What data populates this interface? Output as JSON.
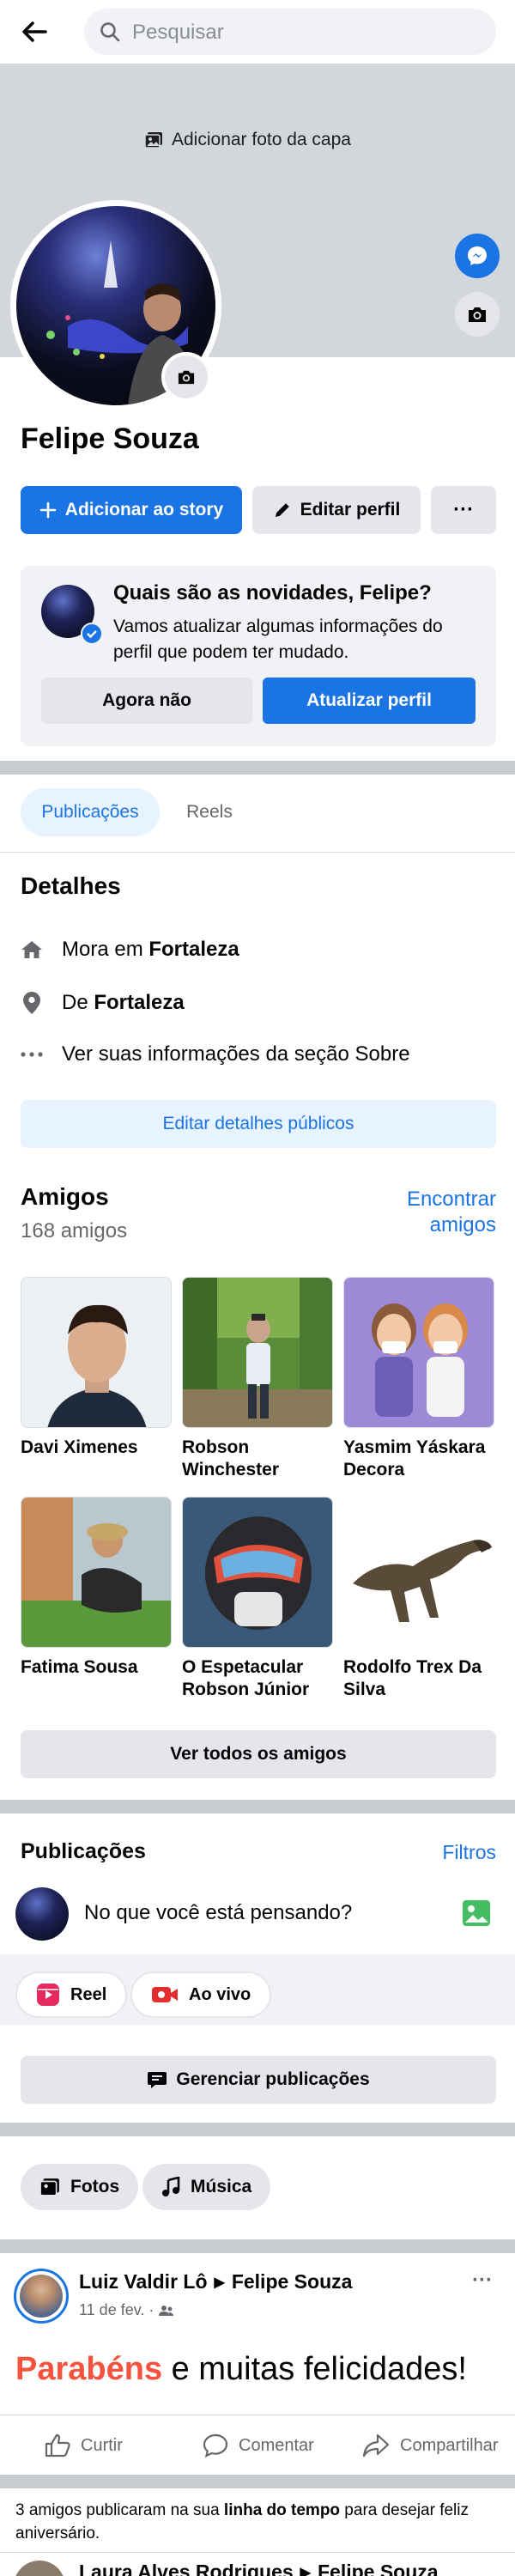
{
  "header": {
    "search_placeholder": "Pesquisar"
  },
  "cover": {
    "add_cover_label": "Adicionar foto da capa"
  },
  "profile": {
    "name": "Felipe Souza",
    "add_story_label": "Adicionar ao story",
    "edit_profile_label": "Editar perfil",
    "more_label": "···"
  },
  "update_card": {
    "title": "Quais são as novidades, Felipe?",
    "body": "Vamos atualizar algumas informações do perfil que podem ter mudado.",
    "not_now_label": "Agora não",
    "update_label": "Atualizar perfil"
  },
  "tabs": [
    {
      "label": "Publicações"
    },
    {
      "label": "Reels"
    }
  ],
  "details": {
    "title": "Detalhes",
    "lives_prefix": "Mora em ",
    "lives_city": "Fortaleza",
    "from_prefix": "De ",
    "from_city": "Fortaleza",
    "about_link": "Ver suas informações da seção Sobre",
    "edit_button": "Editar detalhes públicos"
  },
  "friends": {
    "title": "Amigos",
    "count": "168 amigos",
    "find_line1": "Encontrar",
    "find_line2": "amigos",
    "list": [
      {
        "name": "Davi Ximenes"
      },
      {
        "name": "Robson Winchester"
      },
      {
        "name": "Yasmim Yáskara Decora"
      },
      {
        "name": "Fatima Sousa"
      },
      {
        "name": "O Espetacular Robson Júnior"
      },
      {
        "name": "Rodolfo Trex Da Silva"
      }
    ],
    "see_all": "Ver todos os amigos"
  },
  "posts_section": {
    "title": "Publicações",
    "filters": "Filtros",
    "composer_placeholder": "No que você está pensando?",
    "reel_label": "Reel",
    "live_label": "Ao vivo",
    "manage_label": "Gerenciar publicações",
    "photos_label": "Fotos",
    "music_label": "Música"
  },
  "post": {
    "author": "Luiz Valdir Lô",
    "arrow": "▶",
    "target": "Felipe Souza",
    "date": "11 de fev. ·",
    "text_highlight": "Parabéns",
    "text_rest": " e muitas felicidades!",
    "like": "Curtir",
    "comment": "Comentar",
    "share": "Compartilhar"
  },
  "birthday_note": {
    "prefix": "3 amigos publicaram na sua ",
    "bold": "linha do tempo",
    "suffix": " para desejar feliz aniversário."
  },
  "next_post": {
    "author": "Laura Alves Rodrigues",
    "arrow": "▶",
    "target": "Felipe Souza"
  },
  "colors": {
    "accent": "#1b74e4",
    "highlight": "#f5533d",
    "bg_gray": "#f0f2f5"
  },
  "icons": [
    "back-arrow-icon",
    "search-icon",
    "photo-icon",
    "messenger-icon",
    "camera-icon",
    "plus-icon",
    "pencil-icon",
    "home-icon",
    "location-pin-icon",
    "more-dots-icon",
    "image-icon",
    "reel-icon",
    "live-video-icon",
    "comment-icon",
    "music-icon",
    "like-icon",
    "share-icon",
    "friends-audience-icon"
  ]
}
